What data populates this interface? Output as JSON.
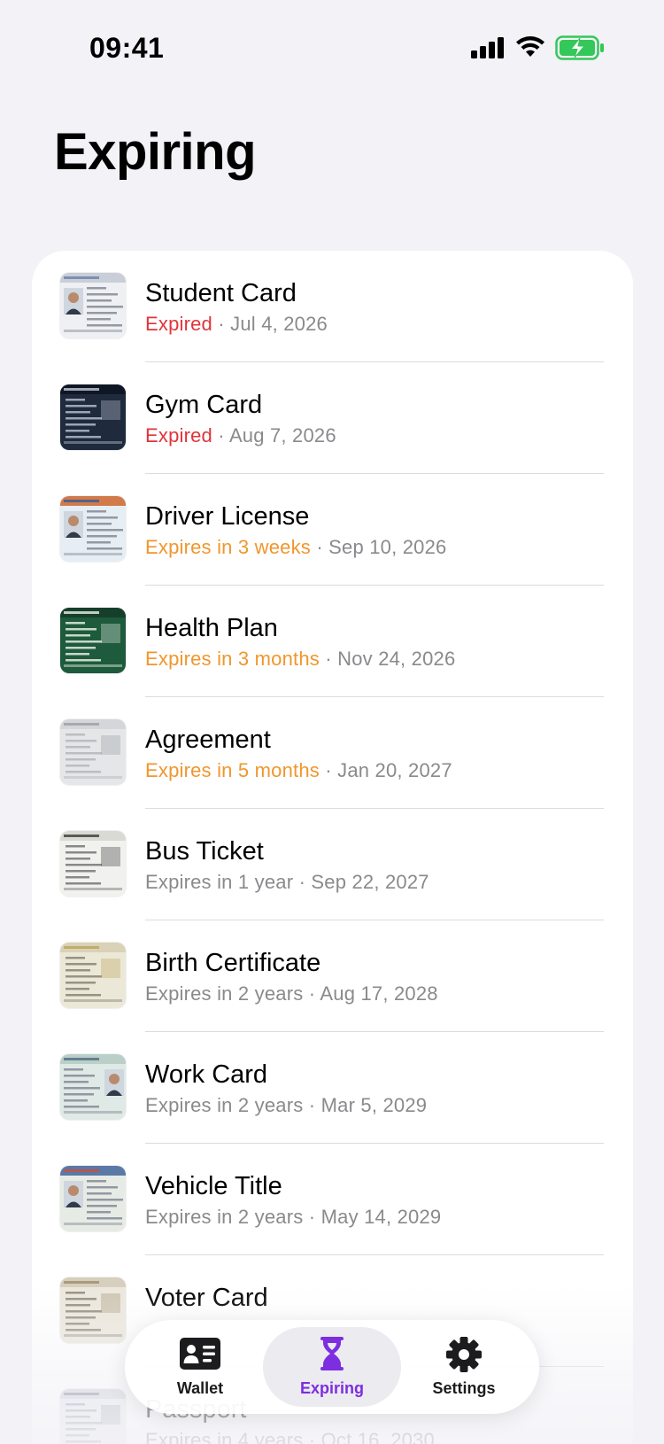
{
  "status_bar": {
    "time": "09:41"
  },
  "page": {
    "title": "Expiring"
  },
  "items": [
    {
      "title": "Student Card",
      "status": "Expired",
      "status_type": "expired",
      "date": "Jul 4, 2026",
      "thumb": "student-card-thumbnail"
    },
    {
      "title": "Gym Card",
      "status": "Expired",
      "status_type": "expired",
      "date": "Aug 7, 2026",
      "thumb": "gym-card-thumbnail"
    },
    {
      "title": "Driver License",
      "status": "Expires in 3 weeks",
      "status_type": "warn",
      "date": "Sep 10, 2026",
      "thumb": "driver-license-thumbnail"
    },
    {
      "title": "Health Plan",
      "status": "Expires in 3 months",
      "status_type": "warn",
      "date": "Nov 24, 2026",
      "thumb": "health-plan-thumbnail"
    },
    {
      "title": "Agreement",
      "status": "Expires in 5 months",
      "status_type": "warn",
      "date": "Jan 20, 2027",
      "thumb": "agreement-thumbnail"
    },
    {
      "title": "Bus Ticket",
      "status": "Expires in 1 year",
      "status_type": "normal",
      "date": "Sep 22, 2027",
      "thumb": "bus-ticket-thumbnail"
    },
    {
      "title": "Birth Certificate",
      "status": "Expires in 2 years",
      "status_type": "normal",
      "date": "Aug 17, 2028",
      "thumb": "birth-certificate-thumbnail"
    },
    {
      "title": "Work Card",
      "status": "Expires in 2 years",
      "status_type": "normal",
      "date": "Mar 5, 2029",
      "thumb": "work-card-thumbnail"
    },
    {
      "title": "Vehicle Title",
      "status": "Expires in 2 years",
      "status_type": "normal",
      "date": "May 14, 2029",
      "thumb": "vehicle-title-thumbnail"
    },
    {
      "title": "Voter Card",
      "status": "",
      "status_type": "normal",
      "date": "",
      "thumb": "voter-card-thumbnail"
    },
    {
      "title": "Passport",
      "status": "Expires in 4 years",
      "status_type": "normal",
      "date": "Oct 16, 2030",
      "thumb": "passport-thumbnail"
    }
  ],
  "separator": " · ",
  "tab_bar": {
    "tabs": [
      {
        "label": "Wallet",
        "icon": "wallet-icon",
        "active": false
      },
      {
        "label": "Expiring",
        "icon": "hourglass-icon",
        "active": true
      },
      {
        "label": "Settings",
        "icon": "gear-icon",
        "active": false
      }
    ]
  },
  "colors": {
    "expired": "#e0343b",
    "warning": "#f0962e",
    "secondary": "#8a8a8e",
    "accent": "#7d2ee0",
    "battery": "#34c759"
  }
}
